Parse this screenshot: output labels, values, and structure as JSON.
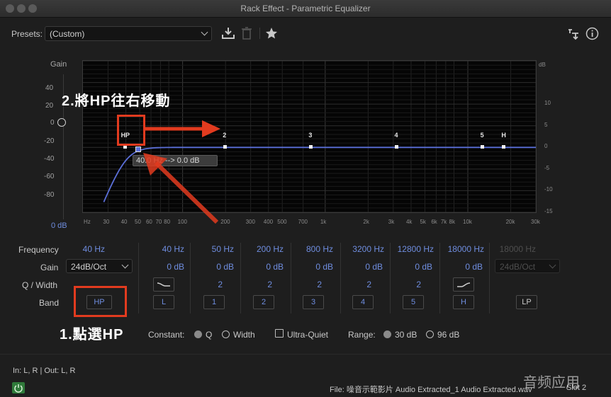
{
  "window": {
    "title": "Rack Effect - Parametric Equalizer"
  },
  "presets": {
    "label": "Presets:",
    "value": "(Custom)"
  },
  "graph": {
    "gain_title": "Gain",
    "gain_ticks": [
      "40",
      "20",
      "0",
      "-20",
      "-40",
      "-60",
      "-80"
    ],
    "gain_bottom": "0 dB",
    "db_title": "dB",
    "db_ticks": [
      "10",
      "5",
      "0",
      "-5",
      "-10",
      "-15"
    ],
    "freq_unit": "Hz",
    "freq_ticks": [
      {
        "v": 30,
        "t": "30"
      },
      {
        "v": 40,
        "t": "40"
      },
      {
        "v": 50,
        "t": "50"
      },
      {
        "v": 60,
        "t": "60"
      },
      {
        "v": 70,
        "t": "70"
      },
      {
        "v": 80,
        "t": "80"
      },
      {
        "v": 100,
        "t": "100"
      },
      {
        "v": 200,
        "t": "200"
      },
      {
        "v": 300,
        "t": "300"
      },
      {
        "v": 400,
        "t": "400"
      },
      {
        "v": 500,
        "t": "500"
      },
      {
        "v": 700,
        "t": "700"
      },
      {
        "v": 1000,
        "t": "1k"
      },
      {
        "v": 2000,
        "t": "2k"
      },
      {
        "v": 3000,
        "t": "3k"
      },
      {
        "v": 4000,
        "t": "4k"
      },
      {
        "v": 5000,
        "t": "5k"
      },
      {
        "v": 6000,
        "t": "6k"
      },
      {
        "v": 7000,
        "t": "7k"
      },
      {
        "v": 8000,
        "t": "8k"
      },
      {
        "v": 10000,
        "t": "10k"
      },
      {
        "v": 20000,
        "t": "20k"
      },
      {
        "v": 30000,
        "t": "30k"
      }
    ],
    "nodes": [
      {
        "label": "HP",
        "freq": 40
      },
      {
        "label": "2",
        "freq": 200
      },
      {
        "label": "3",
        "freq": 800
      },
      {
        "label": "4",
        "freq": 3200
      },
      {
        "label": "5",
        "freq": 12800
      },
      {
        "label": "H",
        "freq": 18000
      }
    ],
    "tooltip": "40.0 Hz --> 0.0 dB"
  },
  "annotations": {
    "step2": "2.將HP往右移動",
    "step1": "1.點選HP"
  },
  "bands": {
    "row_labels": {
      "frequency": "Frequency",
      "gain": "Gain",
      "q": "Q / Width",
      "band": "Band"
    },
    "hp": {
      "frequency": "40 Hz",
      "slope": "24dB/Oct",
      "button": "HP"
    },
    "b1": {
      "frequency": "40 Hz",
      "gain": "0 dB",
      "button": "L"
    },
    "b2": {
      "frequency": "50 Hz",
      "gain": "0 dB",
      "q": "2",
      "button": "1"
    },
    "b3": {
      "frequency": "200 Hz",
      "gain": "0 dB",
      "q": "2",
      "button": "2"
    },
    "b4": {
      "frequency": "800 Hz",
      "gain": "0 dB",
      "q": "2",
      "button": "3"
    },
    "b5": {
      "frequency": "3200 Hz",
      "gain": "0 dB",
      "q": "2",
      "button": "4"
    },
    "b6": {
      "frequency": "12800 Hz",
      "gain": "0 dB",
      "q": "2",
      "button": "5"
    },
    "b7": {
      "frequency": "18000 Hz",
      "gain": "0 dB",
      "button": "H"
    },
    "lp": {
      "frequency": "18000 Hz",
      "slope": "24dB/Oct",
      "button": "LP"
    }
  },
  "options": {
    "constant_label": "Constant:",
    "q_label": "Q",
    "width_label": "Width",
    "ultra_quiet_label": "Ultra-Quiet",
    "range_label": "Range:",
    "range_30": "30 dB",
    "range_96": "96 dB"
  },
  "status": {
    "io": "In: L, R | Out: L, R",
    "file": "File: 噪音示範影片 Audio Extracted_1 Audio Extracted.wav",
    "slot": "Slot 2",
    "watermark": "音频应用"
  },
  "colors": {
    "accent": "#6f8ddf",
    "curve": "#5b6fd8",
    "annotation": "#e23b1f"
  }
}
